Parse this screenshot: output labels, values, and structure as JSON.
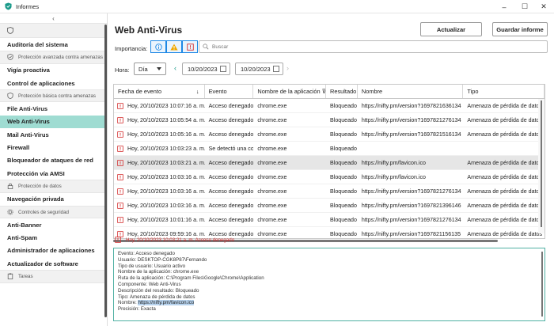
{
  "window": {
    "title": "Informes",
    "controls": {
      "minimize": "–",
      "maximize": "☐",
      "close": "✕"
    },
    "accent": "#1a9a8a"
  },
  "sidebar": {
    "collapse_glyph": "‹",
    "items": [
      {
        "type": "shield"
      },
      {
        "type": "item",
        "label": "Auditoría del sistema"
      },
      {
        "type": "group",
        "label": "Protección avanzada contra amenazas",
        "icon": "shield-check-icon"
      },
      {
        "type": "item",
        "label": "Vigía proactiva"
      },
      {
        "type": "item",
        "label": "Control de aplicaciones"
      },
      {
        "type": "group",
        "label": "Protección básica contra amenazas",
        "icon": "shield-icon"
      },
      {
        "type": "item",
        "label": "File Anti-Virus"
      },
      {
        "type": "item",
        "label": "Web Anti-Virus",
        "active": true
      },
      {
        "type": "item",
        "label": "Mail Anti-Virus"
      },
      {
        "type": "item",
        "label": "Firewall"
      },
      {
        "type": "item",
        "label": "Bloqueador de ataques de red"
      },
      {
        "type": "item",
        "label": "Protección vía AMSI"
      },
      {
        "type": "group",
        "label": "Protección de datos",
        "icon": "lock-icon"
      },
      {
        "type": "item",
        "label": "Navegación privada"
      },
      {
        "type": "group",
        "label": "Controles de seguridad",
        "icon": "gear-icon"
      },
      {
        "type": "item",
        "label": "Anti-Banner"
      },
      {
        "type": "item",
        "label": "Anti-Spam"
      },
      {
        "type": "item",
        "label": "Administrador de aplicaciones"
      },
      {
        "type": "item",
        "label": "Actualizador de software"
      },
      {
        "type": "group",
        "label": "Tareas",
        "icon": "clipboard-icon"
      }
    ]
  },
  "header": {
    "title": "Web Anti-Virus",
    "update_label": "Actualizar",
    "save_label": "Guardar informe"
  },
  "filters": {
    "importance_label": "Importancia:",
    "search_placeholder": "Buscar",
    "hour_label": "Hora:",
    "period_value": "Día",
    "date_from": "10/20/2023",
    "date_to": "10/20/2023"
  },
  "table": {
    "columns": [
      "Fecha de evento",
      "Evento",
      "Nombre de la aplicación",
      "Resultado",
      "Nombre",
      "Tipo"
    ],
    "rows": [
      [
        "Hoy, 20/10/2023 10:07:16 a. m.",
        "Acceso denegado",
        "chrome.exe",
        "Bloqueado",
        "https://nifty.pm/version?1697821636134",
        "Amenaza de pérdida de datos"
      ],
      [
        "Hoy, 20/10/2023 10:05:54 a. m.",
        "Acceso denegado",
        "chrome.exe",
        "Bloqueado",
        "https://nifty.pm/version?1697821276134",
        "Amenaza de pérdida de datos"
      ],
      [
        "Hoy, 20/10/2023 10:05:16 a. m.",
        "Acceso denegado",
        "chrome.exe",
        "Bloqueado",
        "https://nifty.pm/version?1697821516134",
        "Amenaza de pérdida de datos"
      ],
      [
        "Hoy, 20/10/2023 10:03:23 a. m.",
        "Se detectó una co",
        "chrome.exe",
        "Bloqueado",
        "",
        ""
      ],
      [
        "Hoy, 20/10/2023 10:03:21 a. m.",
        "Acceso denegado",
        "chrome.exe",
        "Bloqueado",
        "https://nifty.pm/favicon.ico",
        "Amenaza de pérdida de datos"
      ],
      [
        "Hoy, 20/10/2023 10:03:16 a. m.",
        "Acceso denegado",
        "chrome.exe",
        "Bloqueado",
        "https://nifty.pm/favicon.ico",
        "Amenaza de pérdida de datos"
      ],
      [
        "Hoy, 20/10/2023 10:03:16 a. m.",
        "Acceso denegado",
        "chrome.exe",
        "Bloqueado",
        "https://nifty.pm/version?1697821276134",
        "Amenaza de pérdida de datos"
      ],
      [
        "Hoy, 20/10/2023 10:03:16 a. m.",
        "Acceso denegado",
        "chrome.exe",
        "Bloqueado",
        "https://nifty.pm/version?1697821396146",
        "Amenaza de pérdida de datos"
      ],
      [
        "Hoy, 20/10/2023 10:01:16 a. m.",
        "Acceso denegado",
        "chrome.exe",
        "Bloqueado",
        "https://nifty.pm/version?1697821276134",
        "Amenaza de pérdida de datos"
      ],
      [
        "Hoy, 20/10/2023 09:59:16 a. m.",
        "Acceso denegado",
        "chrome.exe",
        "Bloqueado",
        "https://nifty.pm/version?1697821156135",
        "Amenaza de pérdida de datos"
      ]
    ],
    "selected_row": 4
  },
  "details": {
    "heading": "Hoy, 20/10/2023 10:03:21 a. m. Acceso denegado",
    "lines": [
      "Evento: Acceso denegado",
      "Usuario: DESKTOP-CGK8P87\\Fernando",
      "Tipo de usuario: Usuario activo",
      "Nombre de la aplicación: chrome.exe",
      "Ruta de la aplicación: C:\\Program Files\\Google\\Chrome\\Application",
      "Componente: Web Anti-Virus",
      "Descripción del resultado: Bloqueado",
      "Tipo: Amenaza de pérdida de datos"
    ],
    "name_label": "Nombre: ",
    "name_value": "https://nifty.pm/favicon.ico",
    "precision": "Precisión: Exacta"
  },
  "colors": {
    "active_item": "#9fdcd2",
    "danger": "#d32f2f",
    "warning": "#f0a800",
    "info": "#1e88e5"
  }
}
